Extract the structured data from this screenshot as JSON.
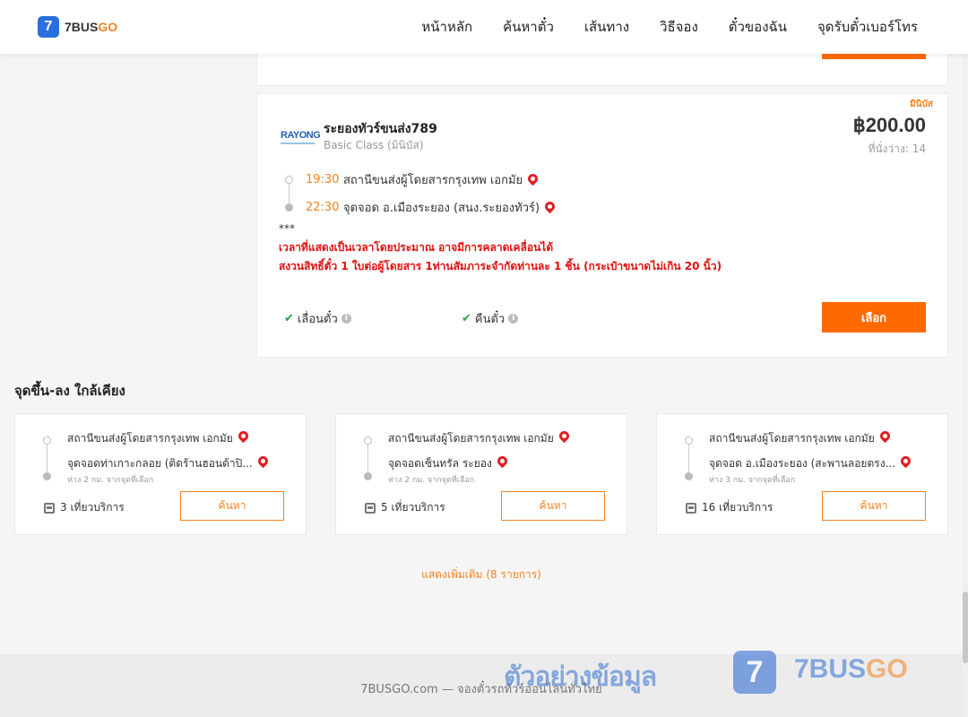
{
  "header": {
    "logo_mark": "7",
    "logo_text_a": "7BUS",
    "logo_text_b": "GO",
    "nav": [
      "หน้าหลัก",
      "ค้นหาตั๋ว",
      "เส้นทาง",
      "วิธีจอง",
      "ตั๋วของฉัน",
      "จุดรับตั๋วเบอร์โทร"
    ]
  },
  "trip": {
    "vehicle_type": "มินิบัส",
    "operator_logo": "RAYONG",
    "operator_name": "ระยองทัวร์ขนส่ง789",
    "class": "Basic Class (มินิบัส)",
    "price": "฿200.00",
    "seats": "ที่นั่งว่าง: 14",
    "departure_time": "19:30",
    "departure_place": "สถานีขนส่งผู้โดยสารกรุงเทพ เอกมัย",
    "arrival_time": "22:30",
    "arrival_place": "จุดจอด อ.เมืองระยอง (สนง.ระยองทัวร์)",
    "note_stars": "***",
    "note_1": "เวลาที่แสดงเป็นเวลาโดยประมาณ อาจมีการคลาดเคลื่อนได้",
    "note_2": "สงวนสิทธิ์ตั๋ว 1 ใบต่อผู้โดยสาร 1ท่านสัมภาระจำกัดท่านละ 1 ชิ้น (กระเป๋าขนาดไม่เกิน 20 นิ้ว)",
    "policy_change": "เลื่อนตั๋ว",
    "policy_refund": "คืนตั๋ว",
    "select_label": "เลือก"
  },
  "nearby": {
    "title": "จุดขึ้น-ลง ใกล้เคียง",
    "cards": [
      {
        "from": "สถานีขนส่งผู้โดยสารกรุงเทพ เอกมัย",
        "to": "จุดจอดท่าเกาะกลอย (ติดร้านฮอนด้าปิ...",
        "distance": "ห่าง 2 กม. จากจุดที่เลือก",
        "trips": "3 เที่ยวบริการ",
        "button": "ค้นหา"
      },
      {
        "from": "สถานีขนส่งผู้โดยสารกรุงเทพ เอกมัย",
        "to": "จุดจอดเซ็นทรัล ระยอง",
        "distance": "ห่าง 2 กม. จากจุดที่เลือก",
        "trips": "5 เที่ยวบริการ",
        "button": "ค้นหา"
      },
      {
        "from": "สถานีขนส่งผู้โดยสารกรุงเทพ เอกมัย",
        "to": "จุดจอด อ.เมืองระยอง (สะพานลอยตรง...",
        "distance": "ห่าง 3 กม. จากจุดที่เลือก",
        "trips": "16 เที่ยวบริการ",
        "button": "ค้นหา"
      }
    ],
    "show_more": "แสดงเพิ่มเติม (8 รายการ)"
  },
  "footer": {
    "text": "7BUSGO.com — จองตั๋วรถทัวร์ออนไลน์ทั่วไทย",
    "watermark_text": "ตัวอย่างข้อมูล",
    "watermark_mark": "7",
    "watermark_brand_a": "7BUS",
    "watermark_brand_b": "GO"
  },
  "colors": {
    "accent": "#ff6a00",
    "brand_blue": "#2a6fdc",
    "warning_red": "#e01010"
  }
}
